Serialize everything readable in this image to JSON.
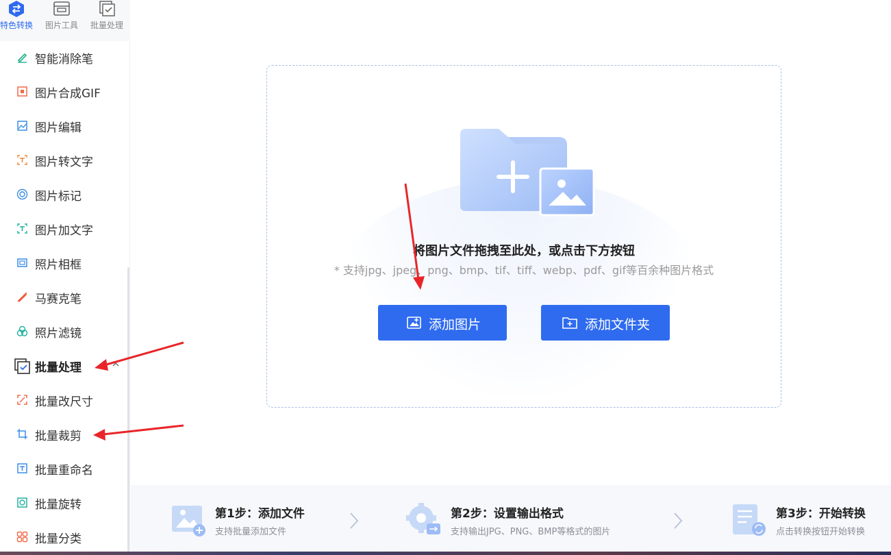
{
  "top_tabs": [
    {
      "label": "特色转换",
      "icon": "convert-icon",
      "active": true
    },
    {
      "label": "图片工具",
      "icon": "image-tool-icon",
      "active": false
    },
    {
      "label": "批量处理",
      "icon": "batch-icon",
      "active": false
    }
  ],
  "sidebar": {
    "items": [
      {
        "label": "智能消除笔",
        "icon": "eraser-pen-icon",
        "color": "#20b08a"
      },
      {
        "label": "图片合成GIF",
        "icon": "gif-icon",
        "color": "#f06a4a"
      },
      {
        "label": "图片编辑",
        "icon": "image-edit-icon",
        "color": "#3a8ee6"
      },
      {
        "label": "图片转文字",
        "icon": "image-to-text-icon",
        "color": "#f0883a"
      },
      {
        "label": "图片标记",
        "icon": "image-mark-icon",
        "color": "#3a8ee6"
      },
      {
        "label": "图片加文字",
        "icon": "add-text-icon",
        "color": "#20b0a0"
      },
      {
        "label": "照片相框",
        "icon": "photo-frame-icon",
        "color": "#3a8ee6"
      },
      {
        "label": "马赛克笔",
        "icon": "mosaic-pen-icon",
        "color": "#f05a3a"
      },
      {
        "label": "照片滤镜",
        "icon": "filter-icon",
        "color": "#20b0a0"
      }
    ],
    "group": {
      "label": "批量处理",
      "icon": "batch-icon",
      "expanded": true
    },
    "group_items": [
      {
        "label": "批量改尺寸",
        "icon": "resize-icon",
        "color": "#f06a4a"
      },
      {
        "label": "批量裁剪",
        "icon": "crop-icon",
        "color": "#3a8ee6"
      },
      {
        "label": "批量重命名",
        "icon": "rename-icon",
        "color": "#3a8ee6"
      },
      {
        "label": "批量旋转",
        "icon": "rotate-icon",
        "color": "#20b0a0"
      },
      {
        "label": "批量分类",
        "icon": "classify-icon",
        "color": "#f06a4a"
      }
    ]
  },
  "dropzone": {
    "title": "将图片文件拖拽至此处，或点击下方按钮",
    "hint": "* 支持jpg、jpeg、png、bmp、tif、tiff、webp、pdf、gif等百余种图片格式",
    "add_image_label": "添加图片",
    "add_folder_label": "添加文件夹"
  },
  "steps": [
    {
      "title": "第1步：添加文件",
      "desc": "支持批量添加文件",
      "icon": "add-file-step-icon"
    },
    {
      "title": "第2步：设置输出格式",
      "desc": "支持输出JPG、PNG、BMP等格式的图片",
      "icon": "settings-step-icon"
    },
    {
      "title": "第3步：开始转换",
      "desc": "点击转换按钮开始转换",
      "icon": "convert-step-icon"
    }
  ],
  "colors": {
    "accent": "#2f6bef",
    "annotation": "#e8262a"
  }
}
